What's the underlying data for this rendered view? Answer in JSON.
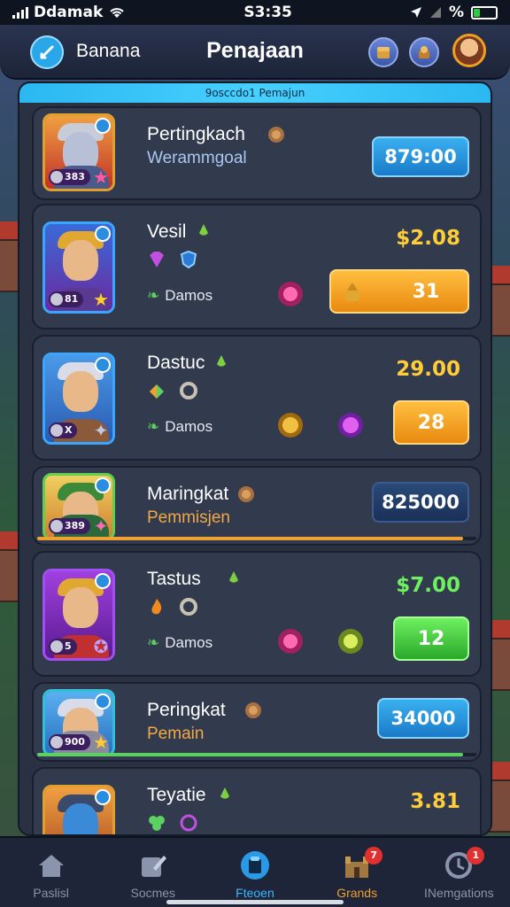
{
  "status_bar": {
    "carrier": "Ddamak",
    "time": "S3:35",
    "battery_text": "%"
  },
  "header": {
    "username": "Banana",
    "title": "Penajaan"
  },
  "banner": {
    "text": "9osccdo1 Pemajun"
  },
  "cards": [
    {
      "kind": "simple",
      "name": "Pertingkach",
      "subtitle": "Werammgoal",
      "avatar_stat": "383",
      "score": "879:00",
      "subtitle_color": "blue",
      "progress": null
    },
    {
      "kind": "full",
      "name": "Vesil",
      "item_label": "Damos",
      "avatar_stat": "81",
      "price": "$2.08",
      "action_label": "31",
      "action_style": "orange"
    },
    {
      "kind": "full",
      "name": "Dastuc",
      "item_label": "Damos",
      "avatar_stat": "X",
      "price": "29.00",
      "action_label": "28",
      "action_style": "orange"
    },
    {
      "kind": "simple",
      "name": "Maringkat",
      "subtitle": "Pemmisjen",
      "avatar_stat": "389",
      "score": "825000",
      "subtitle_color": "orange",
      "progress": {
        "value": 0.97,
        "color": "#f0a030"
      }
    },
    {
      "kind": "full",
      "name": "Tastus",
      "item_label": "Damos",
      "avatar_stat": "5",
      "price": "$7.00",
      "action_label": "12",
      "action_style": "green"
    },
    {
      "kind": "simple",
      "name": "Peringkat",
      "subtitle": "Pemain",
      "avatar_stat": "900",
      "score": "34000",
      "subtitle_color": "orange",
      "progress": {
        "value": 0.97,
        "color": "#5cd060"
      }
    },
    {
      "kind": "full",
      "name": "Teyatie",
      "price": "3.81"
    }
  ],
  "bottom_nav": [
    {
      "label": "Paslisl",
      "icon": "home-icon",
      "badge": ""
    },
    {
      "label": "Socmes",
      "icon": "edit-icon",
      "badge": ""
    },
    {
      "label": "Fteoen",
      "icon": "shop-icon",
      "badge": ""
    },
    {
      "label": "Grands",
      "icon": "castle-icon",
      "badge": "7"
    },
    {
      "label": "INemgations",
      "icon": "notification-icon",
      "badge": "1"
    }
  ],
  "colors": {
    "accent_blue": "#3ab8ff",
    "gold": "#ffcc3a",
    "green": "#6ef060",
    "orange": "#f0a030"
  }
}
